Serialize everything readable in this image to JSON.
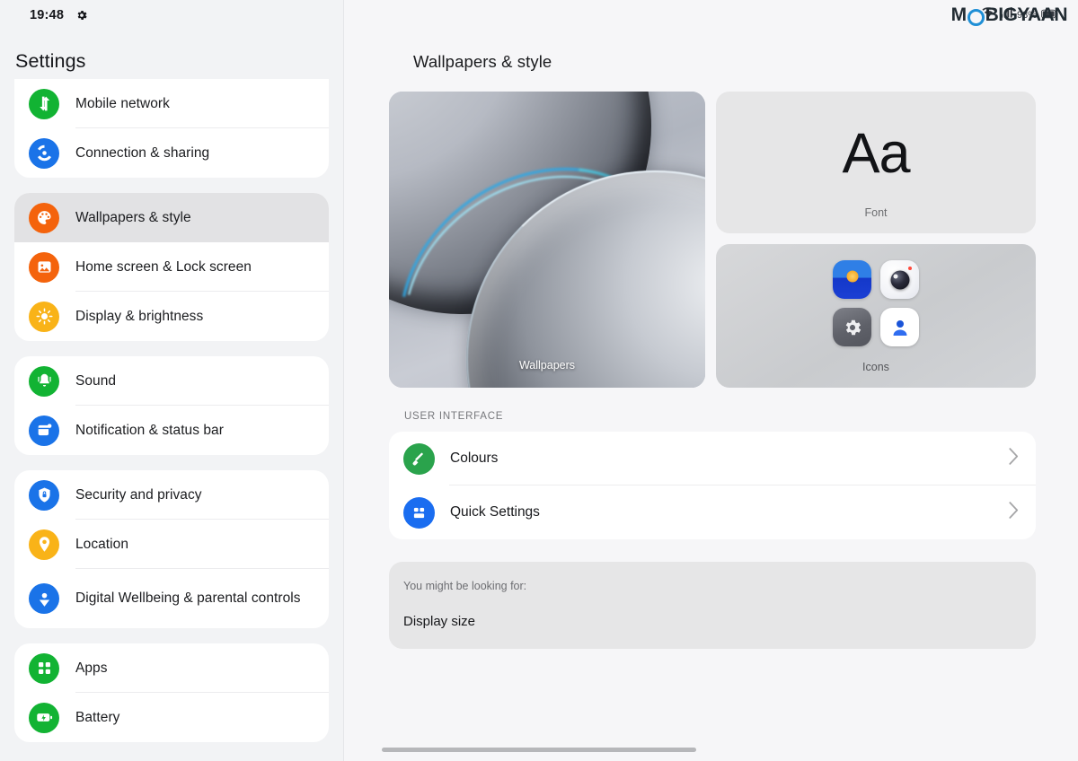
{
  "status_bar": {
    "time": "19:48",
    "gear_icon": "gear-icon",
    "battery_percent": "98%"
  },
  "watermark": {
    "text_before": "M",
    "ring": "O",
    "text_after": "BIGYAAN",
    "full": "MOBIGYAAN"
  },
  "sidebar": {
    "title": "Settings",
    "groups": [
      {
        "clipped_top": true,
        "items": [
          {
            "label": "Mobile network",
            "icon": "mobile-network-icon",
            "color": "#12b333",
            "selected": false
          },
          {
            "label": "Connection & sharing",
            "icon": "connection-sharing-icon",
            "color": "#1a73e8",
            "selected": false
          }
        ]
      },
      {
        "clipped_top": false,
        "items": [
          {
            "label": "Wallpapers & style",
            "icon": "palette-icon",
            "color": "#f4630c",
            "selected": true
          },
          {
            "label": "Home screen & Lock screen",
            "icon": "home-lock-screen-icon",
            "color": "#f4630c",
            "selected": false
          },
          {
            "label": "Display & brightness",
            "icon": "brightness-icon",
            "color": "#f9b318",
            "selected": false
          }
        ]
      },
      {
        "clipped_top": false,
        "items": [
          {
            "label": "Sound",
            "icon": "sound-bell-icon",
            "color": "#12b333",
            "selected": false
          },
          {
            "label": "Notification & status bar",
            "icon": "notification-icon",
            "color": "#1a73e8",
            "selected": false
          }
        ]
      },
      {
        "clipped_top": false,
        "items": [
          {
            "label": "Security and privacy",
            "icon": "shield-lock-icon",
            "color": "#1a73e8",
            "selected": false
          },
          {
            "label": "Location",
            "icon": "location-pin-icon",
            "color": "#f9b318",
            "selected": false
          },
          {
            "label": "Digital Wellbeing & parental controls",
            "icon": "digital-wellbeing-icon",
            "color": "#1a73e8",
            "selected": false,
            "tall": true
          }
        ]
      },
      {
        "clipped_top": false,
        "items": [
          {
            "label": "Apps",
            "icon": "apps-grid-icon",
            "color": "#12b333",
            "selected": false
          },
          {
            "label": "Battery",
            "icon": "battery-icon",
            "color": "#12b333",
            "selected": false
          }
        ]
      }
    ]
  },
  "main": {
    "page_title": "Wallpapers & style",
    "wallpaper_card": {
      "label": "Wallpapers"
    },
    "font_card": {
      "sample": "Aa",
      "label": "Font"
    },
    "icons_card": {
      "label": "Icons",
      "apps": [
        {
          "name": "gallery-app-icon"
        },
        {
          "name": "camera-app-icon"
        },
        {
          "name": "settings-app-icon"
        },
        {
          "name": "contacts-app-icon"
        }
      ]
    },
    "section_header": "USER INTERFACE",
    "ui_rows": [
      {
        "label": "Colours",
        "icon": "paint-roller-icon",
        "color": "#2aa34c",
        "chevron": "chevron-right-icon"
      },
      {
        "label": "Quick Settings",
        "icon": "quick-settings-tiles-icon",
        "color": "#1a6df0",
        "chevron": "chevron-right-icon"
      }
    ],
    "suggestion": {
      "heading": "You might be looking for:",
      "item": "Display size"
    }
  }
}
